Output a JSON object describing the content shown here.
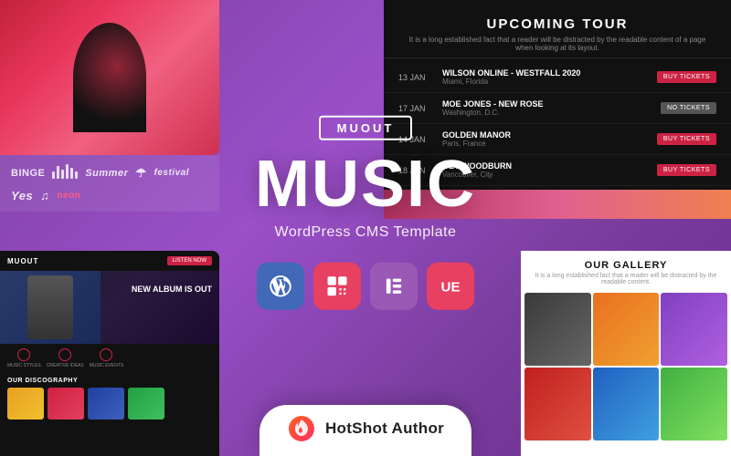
{
  "badge": {
    "label": "MUOUT"
  },
  "main": {
    "title": "MUSIC",
    "subtitle": "WordPress CMS Template"
  },
  "tour": {
    "title": "UPCOMING TOUR",
    "subtitle": "It is a long established fact that a reader will be distracted by the readable content of a page when looking at its layout.",
    "rows": [
      {
        "date": "13 JAN",
        "venue": "WILSON ONLINE - WESTFALL 2020",
        "location": "Miami, Florida",
        "btn": "BUY TICKETS"
      },
      {
        "date": "17 JAN",
        "venue": "MOE JONES - NEW ROSE",
        "location": "Washington, D.C.",
        "btn": "NO TICKETS"
      },
      {
        "date": "14 JAN",
        "venue": "GOLDEN MANOR",
        "location": "Paris, France",
        "btn": "BUY TICKETS"
      },
      {
        "date": "18 JAN",
        "venue": "GET WOODBURN",
        "location": "Vancouver, City",
        "btn": "BUY TICKETS"
      }
    ]
  },
  "gallery": {
    "title": "OUR GALLERY",
    "desc": "It is a long established fact that a reader will be distracted by the readable content."
  },
  "mockup": {
    "logo": "MUOUT",
    "nav_btn": "LISTEN NOW",
    "hero_title": "NEW ALBUM IS OUT",
    "discography_title": "OUR DISCOGRAPHY"
  },
  "plugins": [
    {
      "name": "wordpress",
      "label": "WordPress"
    },
    {
      "name": "quform",
      "label": "Quform"
    },
    {
      "name": "elementor",
      "label": "Elementor"
    },
    {
      "name": "uf",
      "label": "UF"
    }
  ],
  "author": {
    "name": "HotShot Author",
    "icon": "flame"
  }
}
